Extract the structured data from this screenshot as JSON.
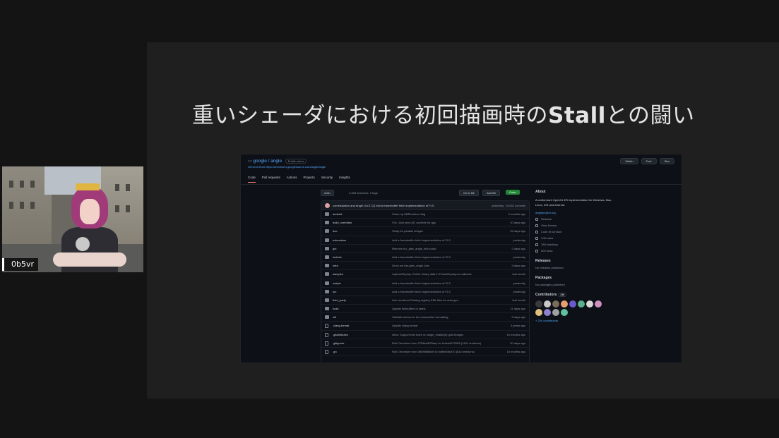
{
  "slide": {
    "title_prefix": "重いシェーダにおける初回描画時の",
    "title_bold": "Stall",
    "title_suffix": "との闘い"
  },
  "github": {
    "owner": "google",
    "repo": "angle",
    "visibility": "Public mirror",
    "mirror_of": "mirrored from https://chromium.googlesource.com/angle/angle",
    "buttons": {
      "watch": "Watch",
      "fork": "Fork",
      "star": "Star"
    },
    "tabs": [
      {
        "label": "Code"
      },
      {
        "label": "Pull requests"
      },
      {
        "label": "Actions"
      },
      {
        "label": "Projects"
      },
      {
        "label": "Security"
      },
      {
        "label": "Insights"
      }
    ],
    "toolbar": {
      "branch": "main",
      "branches": "3,268 branches",
      "tags": "0 tags",
      "goto": "Go to file",
      "add": "Add file",
      "code": "Code"
    },
    "commit": {
      "message": "cornerlalation and Angle LUCI CQ fold a framebuffer fetch implementation of FLS",
      "time": "yesterday",
      "commits": "19,642 commits"
    },
    "files": [
      {
        "name": "android",
        "message": "Clean up UBRenderer flag",
        "date": "2 months ago",
        "type": "folder"
      },
      {
        "name": "build_overrides",
        "message": "VVL: Add new UID override for gpu",
        "date": "10 days ago",
        "type": "folder"
      },
      {
        "name": "doc",
        "message": "Study for parallel images",
        "date": "15 days ago",
        "type": "folder"
      },
      {
        "name": "extensions",
        "message": "Add a framebuffer fetch implementation of FLS",
        "date": "yesterday",
        "type": "folder"
      },
      {
        "name": "gni",
        "message": "Remove src_gles_angle_test script",
        "date": "2 days ago",
        "type": "folder"
      },
      {
        "name": "include",
        "message": "Add a framebuffer fetch implementation of FLS",
        "date": "yesterday",
        "type": "folder"
      },
      {
        "name": "infra",
        "message": "Drum we has gles_angle_test",
        "date": "3 days ago",
        "type": "folder"
      },
      {
        "name": "samples",
        "message": "CaptureReplay: Delete binary data in FrameReplay.rec callback",
        "date": "last month",
        "type": "folder"
      },
      {
        "name": "scripts",
        "message": "Add a framebuffer fetch implementation of FLS",
        "date": "yesterday",
        "type": "folder"
      },
      {
        "name": "src",
        "message": "Add a framebuffer fetch implementation of FLS",
        "date": "yesterday",
        "type": "folder"
      },
      {
        "name": "third_party",
        "message": "Use vendored Glslang registry EML files for auto-gen",
        "date": "last month",
        "type": "folder"
      },
      {
        "name": "tools",
        "message": "Update flexbuffers to latest",
        "date": "11 days ago",
        "type": "folder"
      },
      {
        "name": "util",
        "message": "Validate add src in for consecutive formatting",
        "date": "3 days ago",
        "type": "folder"
      },
      {
        "name": ".clang-format",
        "message": "Update clang-format",
        "date": "3 years ago",
        "type": "file"
      },
      {
        "name": ".gitattributes",
        "message": "vbba: Support rest more on angle_enable(d) gold images",
        "date": "10 months ago",
        "type": "file"
      },
      {
        "name": ".gitignore",
        "message": "Roll Chromium from 2798ee9f20dep to 1a4ea9472008 (1491 revisions)",
        "date": "20 days ago",
        "type": "file"
      },
      {
        "name": ".gn",
        "message": "Roll Chromium from 3bf0f8b8fa00 to bcf6bb0fc870 (814 revisions)",
        "date": "10 months ago",
        "type": "file"
      }
    ],
    "about": {
      "heading": "About",
      "description": "A conformant OpenGL ES implementation for Windows, Mac, Linux, iOS and Android.",
      "link": "angleproject.org",
      "items": [
        "Readme",
        "View license",
        "Code of conduct",
        "3.0k stars",
        "188 watching",
        "500 forks"
      ]
    },
    "releases": {
      "heading": "Releases",
      "sub": "No releases published"
    },
    "packages": {
      "heading": "Packages",
      "sub": "No packages published"
    },
    "contributors": {
      "heading": "Contributors",
      "count": "246",
      "more": "+ 234 contributors",
      "avatar_colors": [
        "#3a3a3a",
        "#c8c8c8",
        "#7a6a5a",
        "#e6a070",
        "#6a5acd",
        "#5ab08a",
        "#d8d8d8",
        "#d090c0",
        "#e0c080",
        "#9080d0",
        "#a0a0a0",
        "#60c0a0"
      ]
    }
  },
  "webcam": {
    "label": "0b5vr"
  }
}
